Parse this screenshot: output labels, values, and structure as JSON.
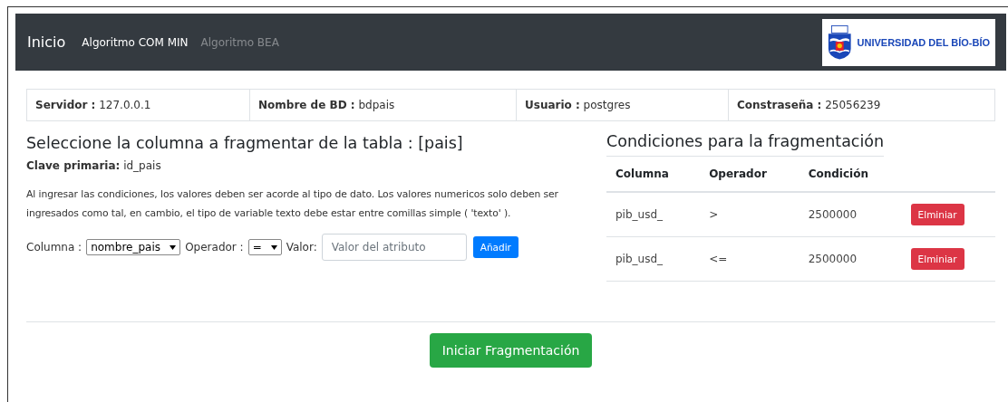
{
  "navbar": {
    "brand": "Inicio",
    "links": [
      {
        "label": "Algoritmo COM MIN",
        "selected": true
      },
      {
        "label": "Algoritmo BEA",
        "selected": false
      }
    ],
    "logo_text": "UNIVERSIDAD DEL BÍO-BÍO"
  },
  "connection": [
    {
      "label": "Servidor :",
      "value": "127.0.0.1"
    },
    {
      "label": "Nombre de BD :",
      "value": "bdpais"
    },
    {
      "label": "Usuario :",
      "value": "postgres"
    },
    {
      "label": "Constraseña :",
      "value": "25056239"
    }
  ],
  "form": {
    "title": "Seleccione la columna a fragmentar de la tabla : [pais]",
    "primary_key_label": "Clave primaria:",
    "primary_key": "id_pais",
    "help": "Al ingresar las condiciones, los valores deben ser acorde al tipo de dato. Los valores numericos solo deben ser ingresados como tal, en cambio, el tipo de variable texto debe estar entre comillas simple ( 'texto' ).",
    "column_label": "Columna :",
    "column_value": "nombre_pais",
    "operator_label": "Operador :",
    "operator_value": "=",
    "value_label": "Valor:",
    "value_placeholder": "Valor del atributo",
    "add_button": "Añadir"
  },
  "conditions": {
    "title": "Condiciones para la fragmentación",
    "columns": [
      "Columna",
      "Operador",
      "Condición"
    ],
    "rows": [
      {
        "column": "pib_usd_",
        "operator": ">",
        "condition": "2500000",
        "button": "Elminiar"
      },
      {
        "column": "pib_usd_",
        "operator": "<=",
        "condition": "2500000",
        "button": "Elminiar"
      }
    ]
  },
  "start_button": "Iniciar Fragmentación"
}
